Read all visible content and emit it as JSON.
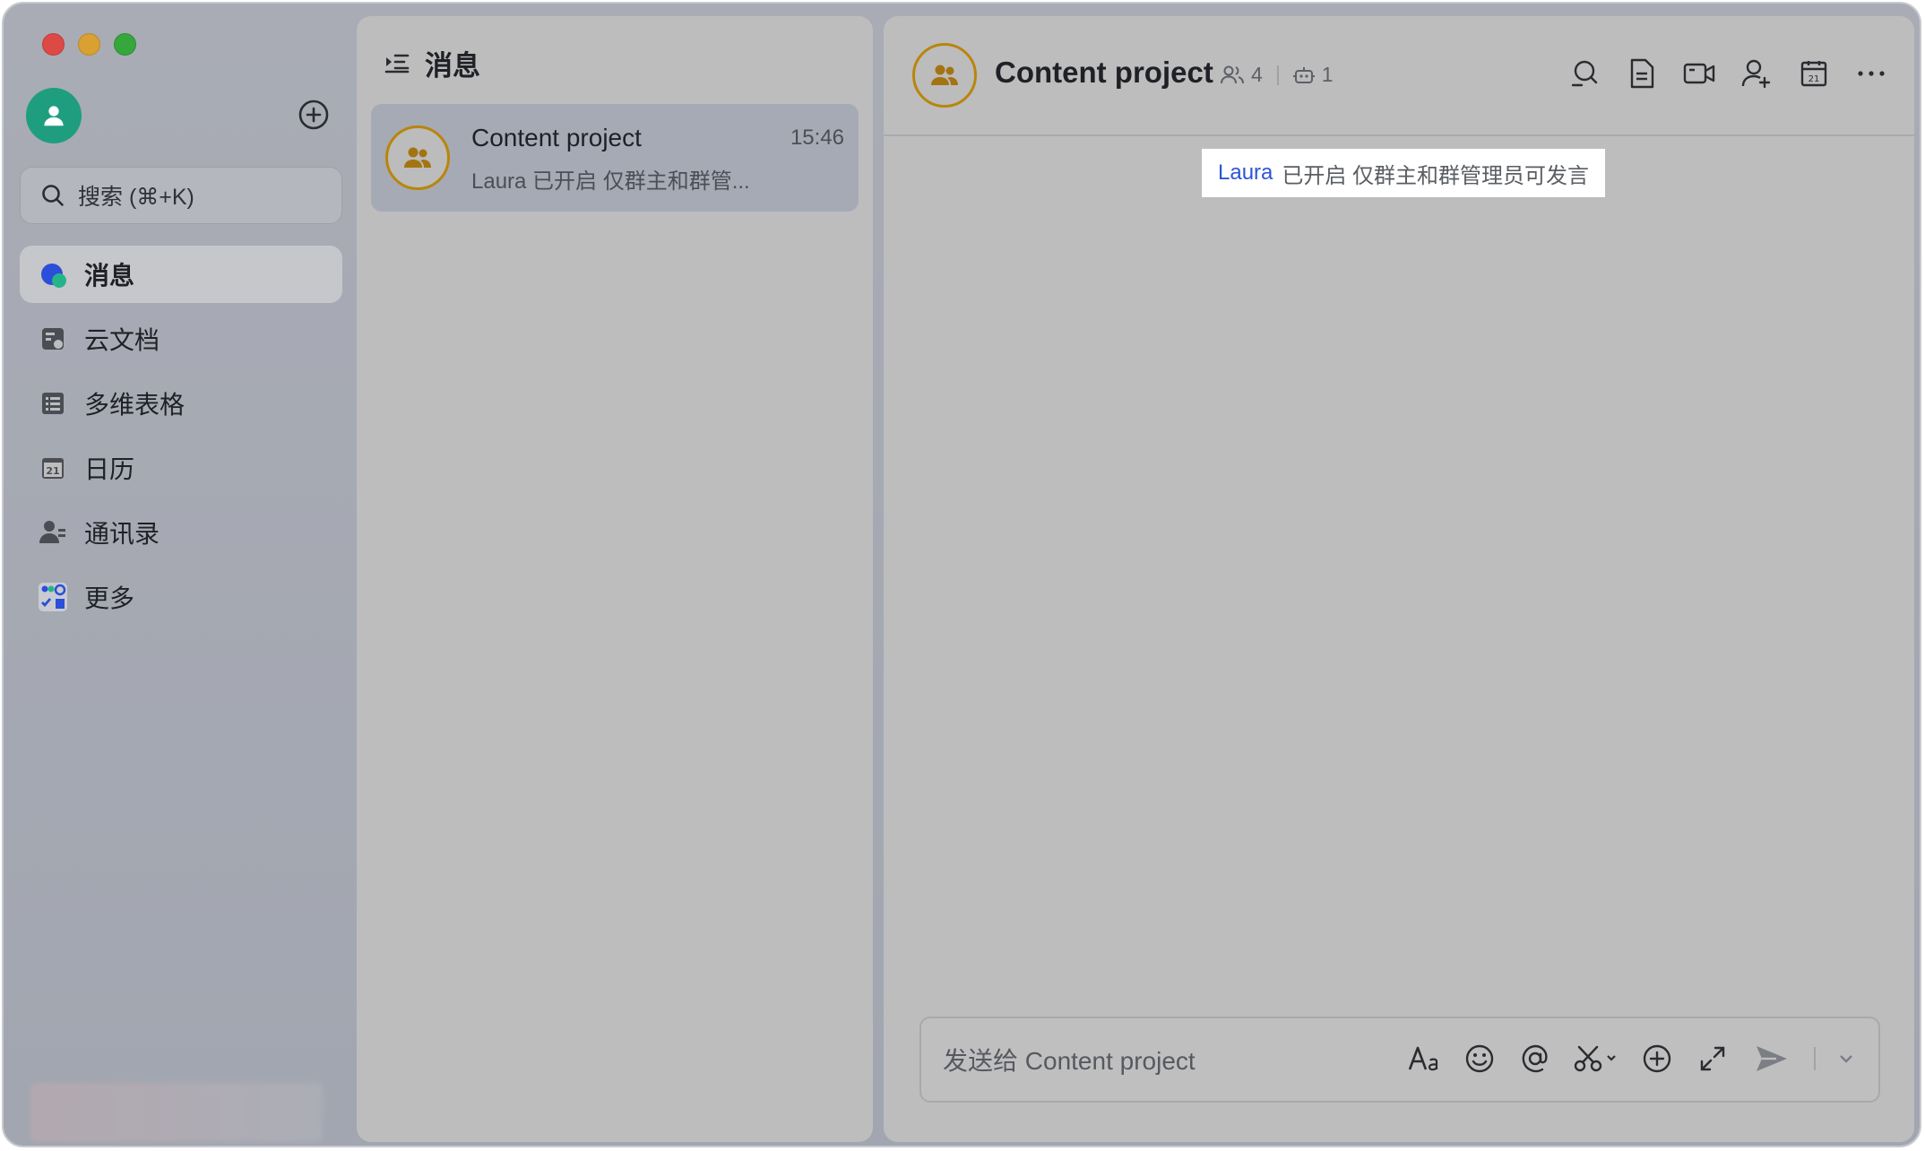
{
  "sidebar": {
    "search_placeholder": "搜索 (⌘+K)",
    "nav": [
      {
        "label": "消息",
        "icon": "messages-icon",
        "active": true
      },
      {
        "label": "云文档",
        "icon": "docs-icon"
      },
      {
        "label": "多维表格",
        "icon": "base-table-icon"
      },
      {
        "label": "日历",
        "icon": "calendar-icon"
      },
      {
        "label": "通讯录",
        "icon": "contacts-icon"
      },
      {
        "label": "更多",
        "icon": "more-apps-icon"
      }
    ]
  },
  "list": {
    "title": "消息",
    "conversations": [
      {
        "name": "Content project",
        "time": "15:46",
        "preview": "Laura 已开启 仅群主和群管..."
      }
    ]
  },
  "chat": {
    "title": "Content project",
    "member_count": "4",
    "bot_count": "1",
    "system_message": {
      "user": "Laura",
      "text": "已开启 仅群主和群管理员可发言"
    },
    "composer_placeholder": "发送给 Content project"
  },
  "colors": {
    "accent_blue": "#2c55d6",
    "avatar_green": "#1f9e7f",
    "group_avatar_ring": "#b8860b"
  }
}
